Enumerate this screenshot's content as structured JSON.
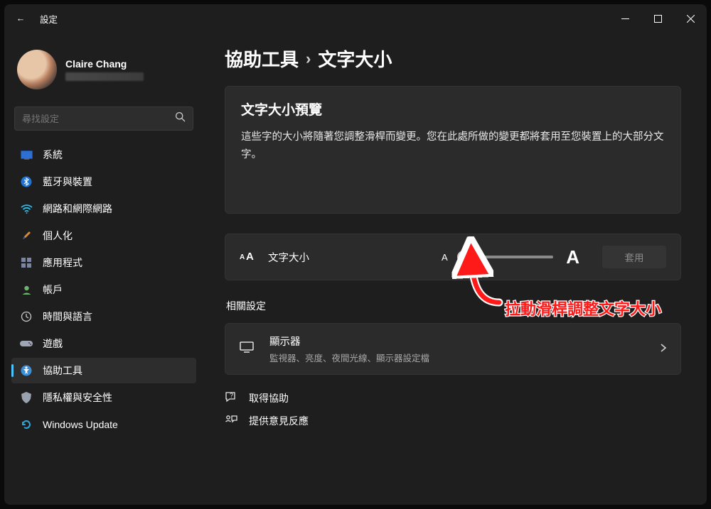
{
  "titlebar": {
    "back_icon": "←",
    "title": "設定"
  },
  "profile": {
    "name": "Claire Chang"
  },
  "search": {
    "placeholder": "尋找設定"
  },
  "nav": {
    "items": [
      {
        "label": "系統",
        "icon": "system"
      },
      {
        "label": "藍牙與裝置",
        "icon": "bluetooth"
      },
      {
        "label": "網路和網際網路",
        "icon": "wifi"
      },
      {
        "label": "個人化",
        "icon": "personalization"
      },
      {
        "label": "應用程式",
        "icon": "apps"
      },
      {
        "label": "帳戶",
        "icon": "accounts"
      },
      {
        "label": "時間與語言",
        "icon": "timelang"
      },
      {
        "label": "遊戲",
        "icon": "gaming"
      },
      {
        "label": "協助工具",
        "icon": "accessibility",
        "active": true
      },
      {
        "label": "隱私權與安全性",
        "icon": "privacy"
      },
      {
        "label": "Windows Update",
        "icon": "update"
      }
    ]
  },
  "breadcrumb": {
    "part1": "協助工具",
    "sep": "›",
    "part2": "文字大小"
  },
  "preview": {
    "title": "文字大小預覽",
    "desc": "這些字的大小將隨著您調整滑桿而變更。您在此處所做的變更都將套用至您裝置上的大部分文字。"
  },
  "slider": {
    "label": "文字大小",
    "small": "A",
    "large": "A",
    "apply": "套用"
  },
  "section": {
    "related": "相關設定"
  },
  "related": {
    "title": "顯示器",
    "sub": "監視器、亮度、夜間光線、顯示器設定檔"
  },
  "help": {
    "get_help": "取得協助",
    "feedback": "提供意見反應"
  },
  "annotation": {
    "text": "拉動滑桿調整文字大小"
  }
}
